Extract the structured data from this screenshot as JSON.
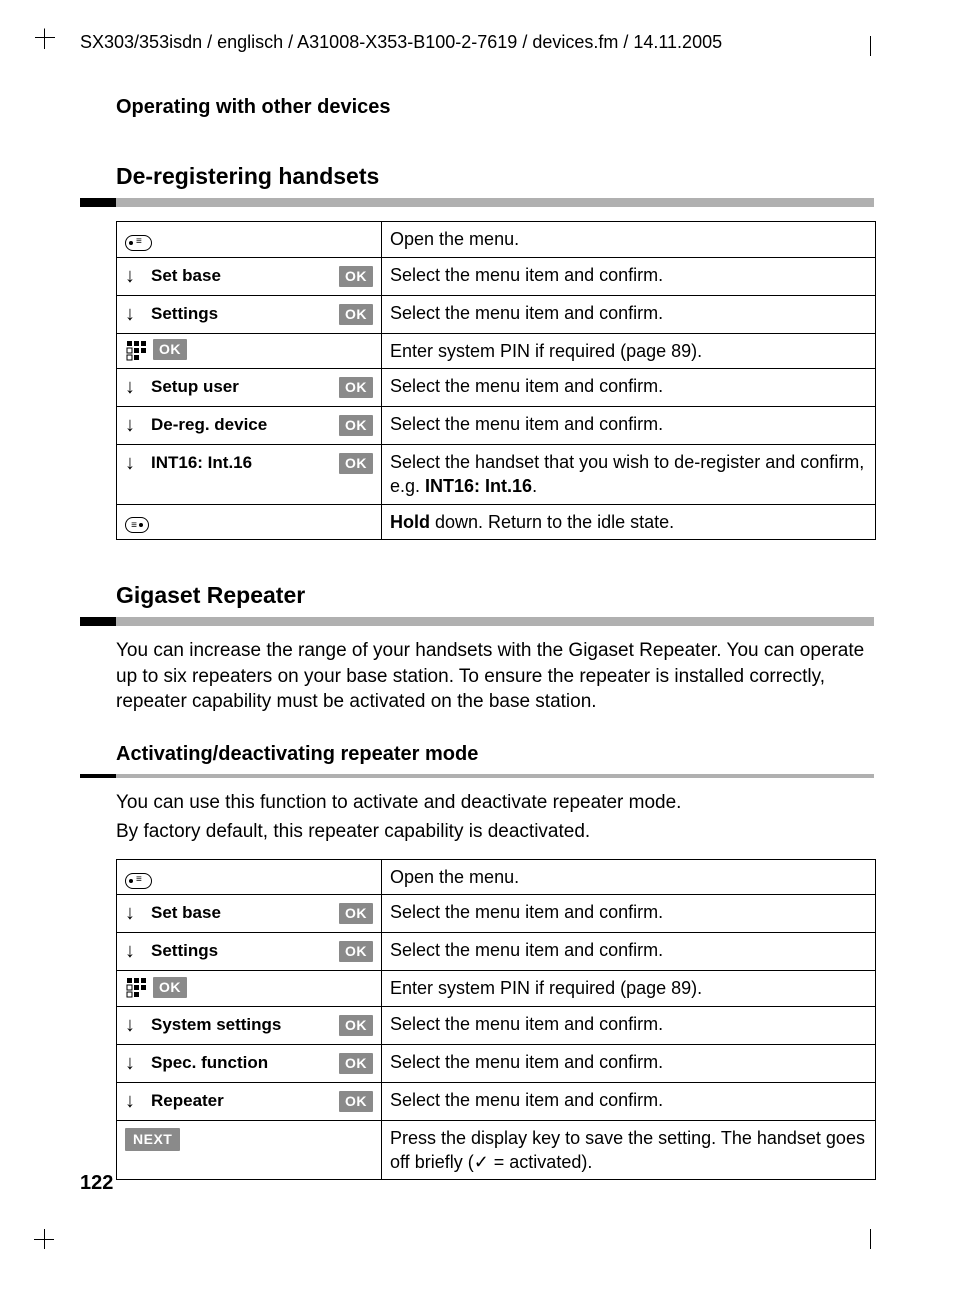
{
  "header_path": "SX303/353isdn / englisch / A31008-X353-B100-2-7619 / devices.fm / 14.11.2005",
  "breadcrumb": "Operating with other devices",
  "section1": {
    "title": "De-registering handsets",
    "rows": [
      {
        "type": "menu_open",
        "desc": "Open the menu."
      },
      {
        "type": "nav",
        "label": "Set base",
        "ok": true,
        "desc": "Select the menu item and confirm."
      },
      {
        "type": "nav",
        "label": "Settings",
        "ok": true,
        "desc": "Select the menu item and confirm."
      },
      {
        "type": "keypad_ok",
        "desc": "Enter system PIN if required (page 89)."
      },
      {
        "type": "nav",
        "label": "Setup user",
        "ok": true,
        "desc": "Select the menu item and confirm."
      },
      {
        "type": "nav",
        "label": "De-reg. device",
        "ok": true,
        "desc": "Select the menu item and confirm."
      },
      {
        "type": "nav",
        "label": "INT16: Int.16",
        "ok": true,
        "desc_html": "Select the handset that you wish to de-register and confirm, e.g. <b>INT16: Int.16</b>."
      },
      {
        "type": "menu_end",
        "desc_html": "<b>Hold</b> down. Return to the idle state."
      }
    ]
  },
  "section2": {
    "title": "Gigaset Repeater",
    "intro": "You can increase the range of your handsets with the Gigaset Repeater. You can operate up to six repeaters on your base station. To ensure the repeater is installed correctly, repeater capability must be activated on the base station.",
    "sub_title": "Activating/deactivating repeater mode",
    "sub_p1": "You can use this function to activate and deactivate repeater mode.",
    "sub_p2": "By factory default, this repeater capability is deactivated.",
    "rows": [
      {
        "type": "menu_open",
        "desc": "Open the menu."
      },
      {
        "type": "nav",
        "label": "Set base",
        "ok": true,
        "desc": "Select the menu item and confirm."
      },
      {
        "type": "nav",
        "label": "Settings",
        "ok": true,
        "desc": "Select the menu item and confirm."
      },
      {
        "type": "keypad_ok",
        "desc": "Enter system PIN if required (page 89)."
      },
      {
        "type": "nav",
        "label": "System settings",
        "ok": true,
        "desc": "Select the menu item and confirm."
      },
      {
        "type": "nav",
        "label": "Spec. function",
        "ok": true,
        "desc": "Select the menu item and confirm."
      },
      {
        "type": "nav",
        "label": "Repeater",
        "ok": true,
        "desc": "Select the menu item and confirm."
      },
      {
        "type": "next",
        "label": "NEXT",
        "desc_html": "Press the display key to save the setting. The handset goes off briefly (✓ = activated)."
      }
    ]
  },
  "ok_text": "OK",
  "page_number": "122"
}
